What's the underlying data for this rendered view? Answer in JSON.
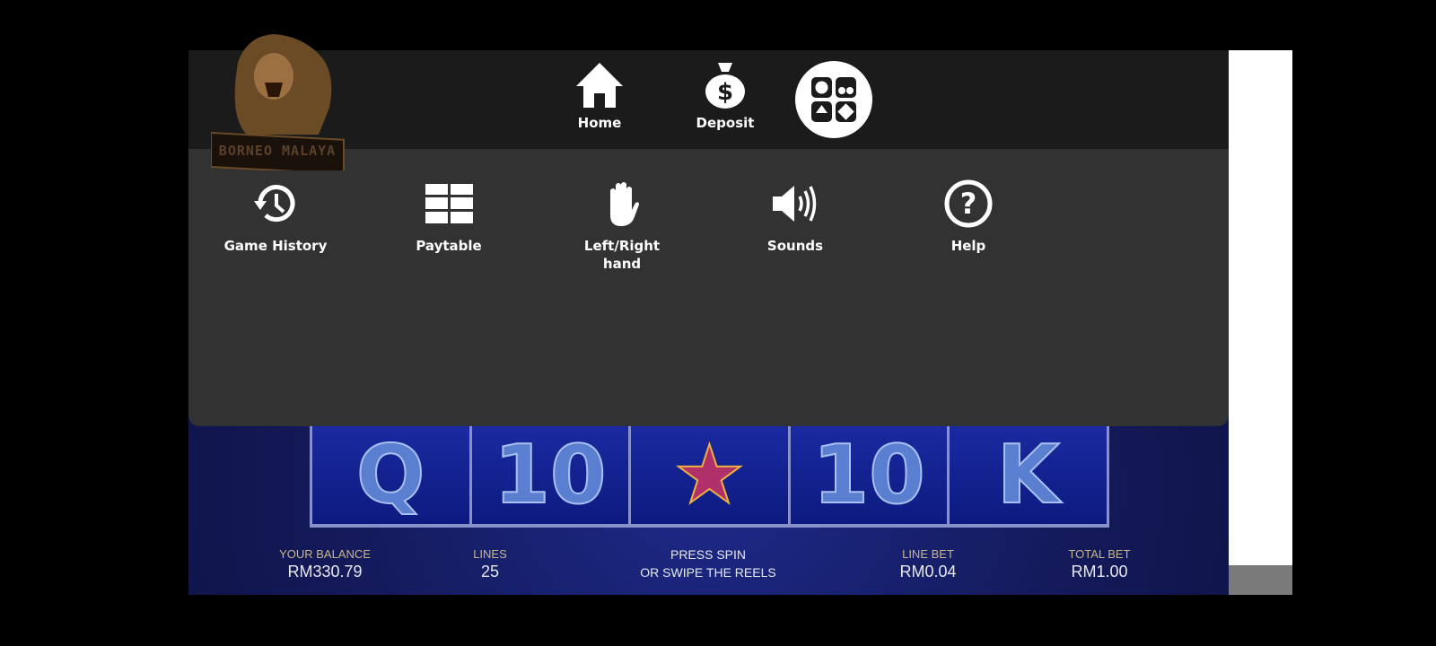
{
  "logo": {
    "text": "BORNEO MALAYA"
  },
  "topnav": [
    {
      "label": "Home",
      "icon": "home-icon"
    },
    {
      "label": "Deposit",
      "icon": "money-bag-icon"
    }
  ],
  "games_button": {
    "icon": "casino-games-icon"
  },
  "menu": [
    {
      "label": "Game History",
      "icon": "history-icon"
    },
    {
      "label": "Paytable",
      "icon": "grid-icon"
    },
    {
      "label": "Left/Right hand",
      "icon": "hand-icon"
    },
    {
      "label": "Sounds",
      "icon": "speaker-icon"
    },
    {
      "label": "Help",
      "icon": "question-icon"
    }
  ],
  "reels": [
    "Q",
    "10",
    "★",
    "10",
    "K"
  ],
  "info": {
    "balance_label": "YOUR BALANCE",
    "balance": "RM330.79",
    "lines_label": "LINES",
    "lines": "25",
    "prompt_1": "PRESS SPIN",
    "prompt_2": "OR SWIPE THE REELS",
    "line_bet_label": "LINE BET",
    "line_bet": "RM0.04",
    "total_bet_label": "TOTAL BET",
    "total_bet": "RM1.00"
  },
  "colors": {
    "topbar": "#1b1b1b",
    "menu": "#323232",
    "label_gold": "#c9b58a"
  }
}
